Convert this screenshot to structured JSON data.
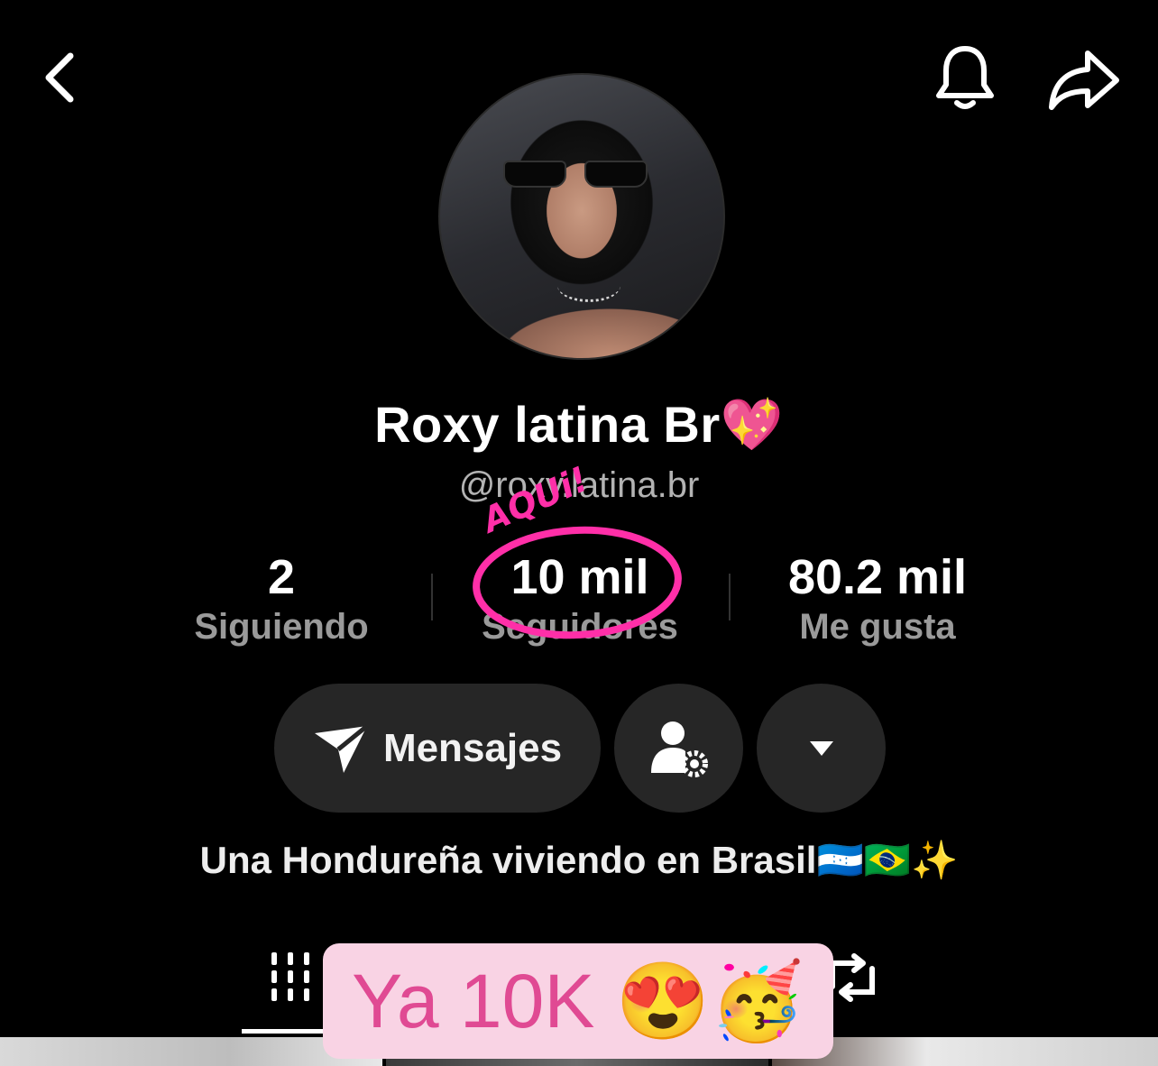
{
  "header": {
    "back_icon": "chevron-left-icon",
    "bell_icon": "bell-icon",
    "share_icon": "share-arrow-icon"
  },
  "profile": {
    "display_name": "Roxy latina Br💖",
    "username": "@roxy.latina.br",
    "bio": "Una Hondureña viviendo en Brasil🇭🇳🇧🇷✨"
  },
  "stats": [
    {
      "value": "2",
      "label": "Siguiendo"
    },
    {
      "value": "10 mil",
      "label": "Seguidores"
    },
    {
      "value": "80.2 mil",
      "label": "Me gusta"
    }
  ],
  "actions": {
    "message_label": "Mensajes",
    "message_icon": "paper-plane-icon",
    "profile_settings_icon": "user-gear-icon",
    "dropdown_icon": "caret-down-icon"
  },
  "annotations": {
    "highlight_text": "AQUi!",
    "highlight_color": "#ff2fa8",
    "sticker_text": "Ya 10K 😍🥳",
    "sticker_bg": "#f9d3e4",
    "sticker_color": "#e04a93"
  },
  "tabs": {
    "videos_icon": "grid-icon",
    "reposts_icon": "repost-icon"
  }
}
